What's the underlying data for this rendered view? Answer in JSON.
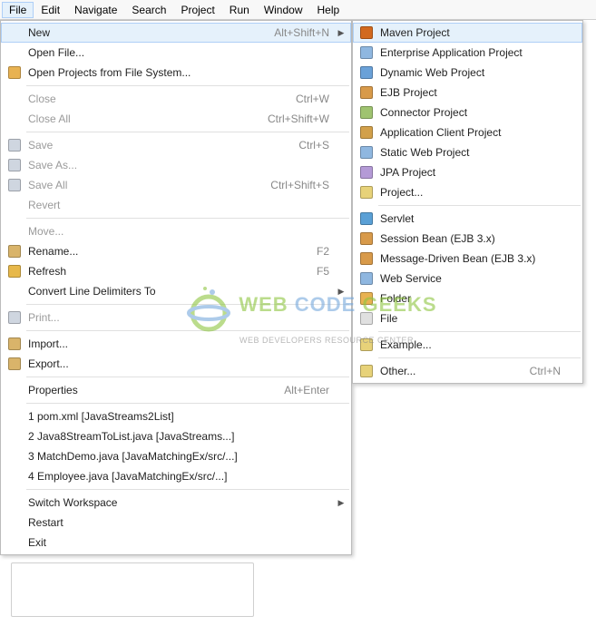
{
  "menubar": [
    "File",
    "Edit",
    "Navigate",
    "Search",
    "Project",
    "Run",
    "Window",
    "Help"
  ],
  "fileMenu": {
    "groups": [
      [
        {
          "label": "New",
          "shortcut": "Alt+Shift+N",
          "arrow": true,
          "highlight": true,
          "icon": null,
          "name": "menu-new"
        },
        {
          "label": "Open File...",
          "icon": null,
          "name": "menu-open-file"
        },
        {
          "label": "Open Projects from File System...",
          "icon": "folder-open",
          "name": "menu-open-projects-fs"
        }
      ],
      [
        {
          "label": "Close",
          "shortcut": "Ctrl+W",
          "disabled": true,
          "name": "menu-close"
        },
        {
          "label": "Close All",
          "shortcut": "Ctrl+Shift+W",
          "disabled": true,
          "name": "menu-close-all"
        }
      ],
      [
        {
          "label": "Save",
          "shortcut": "Ctrl+S",
          "disabled": true,
          "icon": "disk",
          "name": "menu-save"
        },
        {
          "label": "Save As...",
          "disabled": true,
          "icon": "disk",
          "name": "menu-save-as"
        },
        {
          "label": "Save All",
          "shortcut": "Ctrl+Shift+S",
          "disabled": true,
          "icon": "disks",
          "name": "menu-save-all"
        },
        {
          "label": "Revert",
          "disabled": true,
          "name": "menu-revert"
        }
      ],
      [
        {
          "label": "Move...",
          "disabled": true,
          "name": "menu-move"
        },
        {
          "label": "Rename...",
          "shortcut": "F2",
          "icon": "rename",
          "name": "menu-rename"
        },
        {
          "label": "Refresh",
          "shortcut": "F5",
          "icon": "refresh",
          "name": "menu-refresh"
        },
        {
          "label": "Convert Line Delimiters To",
          "arrow": true,
          "name": "menu-convert-delimiters"
        }
      ],
      [
        {
          "label": "Print...",
          "disabled": true,
          "icon": "print",
          "name": "menu-print"
        }
      ],
      [
        {
          "label": "Import...",
          "icon": "import",
          "name": "menu-import"
        },
        {
          "label": "Export...",
          "icon": "export",
          "name": "menu-export"
        }
      ],
      [
        {
          "label": "Properties",
          "shortcut": "Alt+Enter",
          "name": "menu-properties"
        }
      ],
      [
        {
          "label": "1 pom.xml  [JavaStreams2List]",
          "name": "menu-recent-1"
        },
        {
          "label": "2 Java8StreamToList.java  [JavaStreams...]",
          "name": "menu-recent-2"
        },
        {
          "label": "3 MatchDemo.java  [JavaMatchingEx/src/...]",
          "name": "menu-recent-3"
        },
        {
          "label": "4 Employee.java  [JavaMatchingEx/src/...]",
          "name": "menu-recent-4"
        }
      ],
      [
        {
          "label": "Switch Workspace",
          "arrow": true,
          "name": "menu-switch-workspace"
        },
        {
          "label": "Restart",
          "name": "menu-restart"
        },
        {
          "label": "Exit",
          "name": "menu-exit"
        }
      ]
    ]
  },
  "newSubmenu": {
    "groups": [
      [
        {
          "label": "Maven Project",
          "highlight": true,
          "icon": "maven",
          "name": "submenu-maven-project"
        },
        {
          "label": "Enterprise Application Project",
          "icon": "ear",
          "name": "submenu-ear-project"
        },
        {
          "label": "Dynamic Web Project",
          "icon": "dynweb",
          "name": "submenu-dynamic-web-project"
        },
        {
          "label": "EJB Project",
          "icon": "ejb",
          "name": "submenu-ejb-project"
        },
        {
          "label": "Connector Project",
          "icon": "connector",
          "name": "submenu-connector-project"
        },
        {
          "label": "Application Client Project",
          "icon": "appclient",
          "name": "submenu-app-client-project"
        },
        {
          "label": "Static Web Project",
          "icon": "staticweb",
          "name": "submenu-static-web-project"
        },
        {
          "label": "JPA Project",
          "icon": "jpa",
          "name": "submenu-jpa-project"
        },
        {
          "label": "Project...",
          "icon": "project",
          "name": "submenu-project"
        }
      ],
      [
        {
          "label": "Servlet",
          "icon": "servlet",
          "name": "submenu-servlet"
        },
        {
          "label": "Session Bean (EJB 3.x)",
          "icon": "bean",
          "name": "submenu-session-bean"
        },
        {
          "label": "Message-Driven Bean (EJB 3.x)",
          "icon": "bean",
          "name": "submenu-message-bean"
        },
        {
          "label": "Web Service",
          "icon": "ws",
          "name": "submenu-web-service"
        },
        {
          "label": "Folder",
          "icon": "folder",
          "name": "submenu-folder"
        },
        {
          "label": "File",
          "icon": "file",
          "name": "submenu-file"
        }
      ],
      [
        {
          "label": "Example...",
          "icon": "example",
          "name": "submenu-example"
        }
      ],
      [
        {
          "label": "Other...",
          "shortcut": "Ctrl+N",
          "icon": "other",
          "name": "submenu-other"
        }
      ]
    ]
  },
  "watermark": {
    "line1a": "WEB ",
    "line1b": "CODE ",
    "line1c": "GEEKS",
    "line2": "WEB DEVELOPERS RESOURCE CENTER"
  },
  "iconColors": {
    "folder-open": "#e8b252",
    "disk": "#cfd6e0",
    "disks": "#cfd6e0",
    "rename": "#d9b46a",
    "refresh": "#e7b84a",
    "print": "#cfd6e0",
    "import": "#d9b46a",
    "export": "#d9b46a",
    "maven": "#d2691e",
    "ear": "#8fb7e0",
    "dynweb": "#6aa1d8",
    "ejb": "#d89a4a",
    "connector": "#9fc370",
    "appclient": "#d2a04a",
    "staticweb": "#8fb7e0",
    "jpa": "#b49ad6",
    "project": "#e7d279",
    "servlet": "#5aa0d6",
    "bean": "#d89a4a",
    "ws": "#8fb7e0",
    "folder": "#e8b252",
    "file": "#e0e0e0",
    "example": "#e7d279",
    "other": "#e7d279"
  }
}
